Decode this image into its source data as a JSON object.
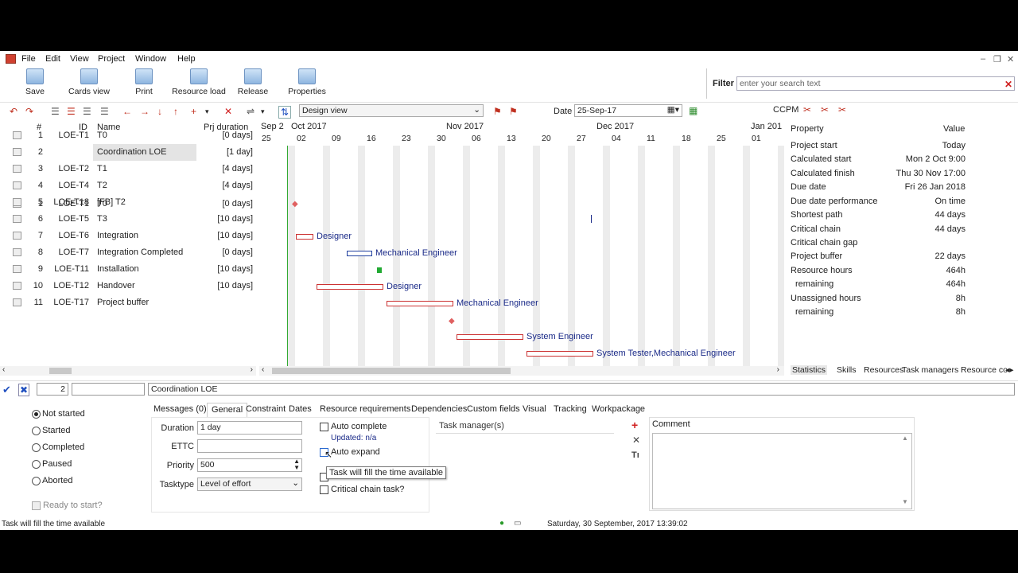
{
  "menu": [
    "File",
    "Edit",
    "View",
    "Project",
    "Window",
    "Help"
  ],
  "toolbar": {
    "buttons": [
      "Save",
      "Cards view",
      "Print",
      "Resource load",
      "Release",
      "Properties"
    ],
    "filter_label": "Filter",
    "filter_placeholder": "enter your search text",
    "view_select": "Design view",
    "date_label": "Date",
    "date_value": "25-Sep-17",
    "ccpm_label": "CCPM"
  },
  "grid": {
    "columns": [
      "#",
      "ID",
      "Name",
      "Prj duration"
    ],
    "rows": [
      {
        "num": "1",
        "id": "LOE-T1",
        "name": "T0",
        "duration": "[0 days]"
      },
      {
        "num": "2",
        "id": "",
        "name": "Coordination LOE",
        "duration": "[1 day]"
      },
      {
        "num": "3",
        "id": "LOE-T2",
        "name": "T1",
        "duration": "[4 days]"
      },
      {
        "num": "4",
        "id": "LOE-T4",
        "name": "T2",
        "duration": "[4 days]"
      },
      {
        "num": "5",
        "id": "LOE-T18",
        "name": "[FB] T2",
        "duration": ""
      },
      {
        "num": "6",
        "id": "LOE-T5",
        "name": "T3",
        "duration": "[10 days]"
      },
      {
        "num": "7",
        "id": "LOE-T6",
        "name": "Integration",
        "duration": "[10 days]"
      },
      {
        "num": "8",
        "id": "LOE-T7",
        "name": "Integration Completed",
        "duration": "[0 days]"
      },
      {
        "num": "9",
        "id": "LOE-T11",
        "name": "Installation",
        "duration": "[10 days]"
      },
      {
        "num": "10",
        "id": "LOE-T12",
        "name": "Handover",
        "duration": "[10 days]"
      },
      {
        "num": "11",
        "id": "LOE-T17",
        "name": "Project buffer",
        "duration": ""
      }
    ]
  },
  "gantt": {
    "months": [
      "Sep 2",
      "Oct 2017",
      "Nov 2017",
      "Dec 2017",
      "Jan 201"
    ],
    "days": [
      "25",
      "02",
      "09",
      "16",
      "23",
      "30",
      "06",
      "13",
      "20",
      "27",
      "04",
      "11",
      "18",
      "25",
      "01"
    ],
    "labels": [
      "Designer",
      "Mechanical Engineer",
      "Designer",
      "Mechanical Engineer",
      "System Engineer",
      "System Tester,Mechanical Engineer"
    ]
  },
  "properties": {
    "header_property": "Property",
    "header_value": "Value",
    "rows": [
      {
        "name": "Project start",
        "value": "Today"
      },
      {
        "name": "Calculated start",
        "value": "Mon 2 Oct 9:00"
      },
      {
        "name": "Calculated finish",
        "value": "Thu 30 Nov 17:00"
      },
      {
        "name": "Due date",
        "value": "Fri 26 Jan 2018"
      },
      {
        "name": "Due date performance",
        "value": "On time"
      },
      {
        "name": "Shortest path",
        "value": "44 days"
      },
      {
        "name": "Critical chain",
        "value": "44 days"
      },
      {
        "name": "Critical chain gap",
        "value": ""
      },
      {
        "name": "Project buffer",
        "value": "22 days"
      },
      {
        "name": "Resource hours",
        "value": "464h"
      },
      {
        "name": "  remaining",
        "value": "464h"
      },
      {
        "name": "Unassigned hours",
        "value": "8h"
      },
      {
        "name": "  remaining",
        "value": "8h"
      }
    ],
    "tabs": [
      "Statistics",
      "Skills",
      "Resources",
      "Task managers",
      "Resource co"
    ]
  },
  "editline": {
    "row_number": "2",
    "task_name": "Coordination LOE"
  },
  "detail_tabs": [
    "Messages (0)",
    "General",
    "Constraint",
    "Dates",
    "Resource requirements",
    "Dependencies",
    "Custom fields",
    "Visual",
    "Tracking",
    "Workpackage"
  ],
  "status": {
    "options": [
      "Not started",
      "Started",
      "Completed",
      "Paused",
      "Aborted"
    ],
    "selected": "Not started",
    "ready_label": "Ready to start?"
  },
  "general": {
    "duration_label": "Duration",
    "duration_value": "1 day",
    "ettc_label": "ETTC",
    "ettc_value": "",
    "priority_label": "Priority",
    "priority_value": "500",
    "tasktype_label": "Tasktype",
    "tasktype_value": "Level of effort",
    "auto_complete": "Auto complete",
    "updated": "Updated: n/a",
    "auto_expand": "Auto expand",
    "critical_chain": "Critical chain task?",
    "task_managers": "Task manager(s)",
    "comment": "Comment"
  },
  "tooltip": "Task will fill the time available",
  "statusbar": {
    "left": "Task will fill the time available",
    "datetime": "Saturday, 30 September, 2017 13:39:02"
  }
}
